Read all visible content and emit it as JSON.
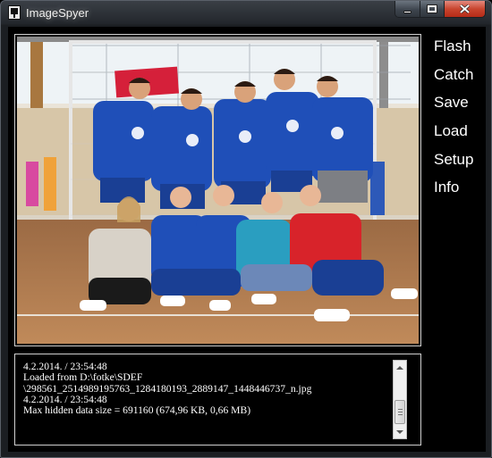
{
  "window": {
    "title": "ImageSpyer"
  },
  "menu": {
    "items": [
      {
        "label": "Flash"
      },
      {
        "label": "Catch"
      },
      {
        "label": "Save"
      },
      {
        "label": "Load"
      },
      {
        "label": "Setup"
      },
      {
        "label": "Info"
      }
    ]
  },
  "log": {
    "lines": [
      "4.2.2014. / 23:54:48",
      "Loaded from D:\\fotke\\SDEF",
      "\\298561_2514989195763_1284180193_2889147_1448446737_n.jpg",
      "4.2.2014. / 23:54:48",
      "Max hidden data size = 691160 (674,96 KB, 0,66 MB)"
    ]
  },
  "photo": {
    "subject": "team photo of futsal players in blue jerseys in a sports hall"
  },
  "colors": {
    "background": "#000000",
    "text": "#ffffff",
    "close_button": "#c8452f",
    "jersey_blue": "#1f4fb8",
    "jersey_red": "#d8232a",
    "court_floor": "#b07a4e"
  }
}
